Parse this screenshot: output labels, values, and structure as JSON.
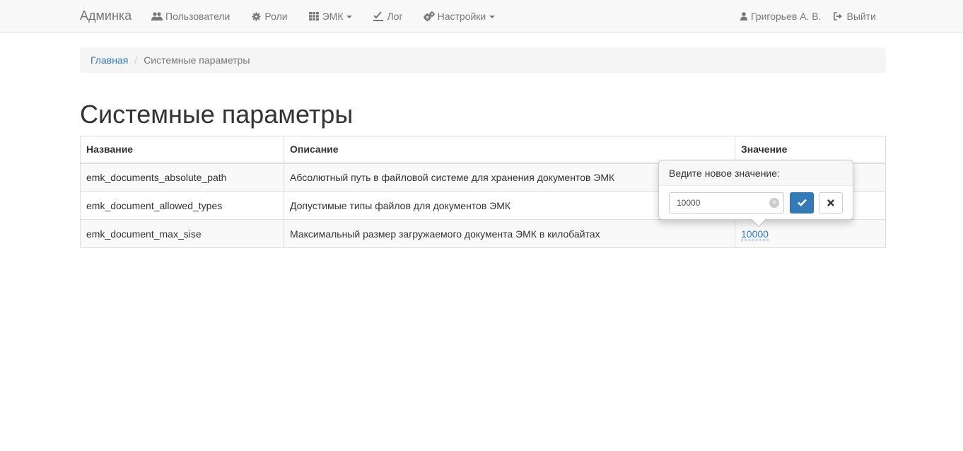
{
  "navbar": {
    "brand": "Админка",
    "items": [
      {
        "label": "Пользователи",
        "icon": "users-icon",
        "dropdown": false
      },
      {
        "label": "Роли",
        "icon": "cog-icon",
        "dropdown": false
      },
      {
        "label": "ЭМК",
        "icon": "grid-icon",
        "dropdown": true
      },
      {
        "label": "Лог",
        "icon": "check-list-icon",
        "dropdown": false
      },
      {
        "label": "Настройки",
        "icon": "cogs-icon",
        "dropdown": true
      }
    ],
    "user": {
      "label": "Григорьев А. В.",
      "icon": "user-icon"
    },
    "logout": {
      "label": "Выйти",
      "icon": "logout-icon"
    }
  },
  "breadcrumb": {
    "home": "Главная",
    "separator": "/",
    "current": "Системные параметры"
  },
  "page": {
    "title": "Системные параметры"
  },
  "table": {
    "headers": [
      "Название",
      "Описание",
      "Значение"
    ],
    "rows": [
      {
        "name": "emk_documents_absolute_path",
        "description": "Абсолютный путь в файловой системе для хранения документов ЭМК",
        "value": ""
      },
      {
        "name": "emk_document_allowed_types",
        "description": "Допустимые типы файлов для документов ЭМК",
        "value": ""
      },
      {
        "name": "emk_document_max_sise",
        "description": "Максимальный размер загружаемого документа ЭМК в килобайтах",
        "value": "10000"
      }
    ]
  },
  "popover": {
    "title": "Ведите новое значение:",
    "input_value": "10000",
    "clear_icon": "×"
  },
  "colors": {
    "link": "#337ab7",
    "navbar_bg": "#f8f8f8",
    "primary_button": "#337ab7"
  }
}
